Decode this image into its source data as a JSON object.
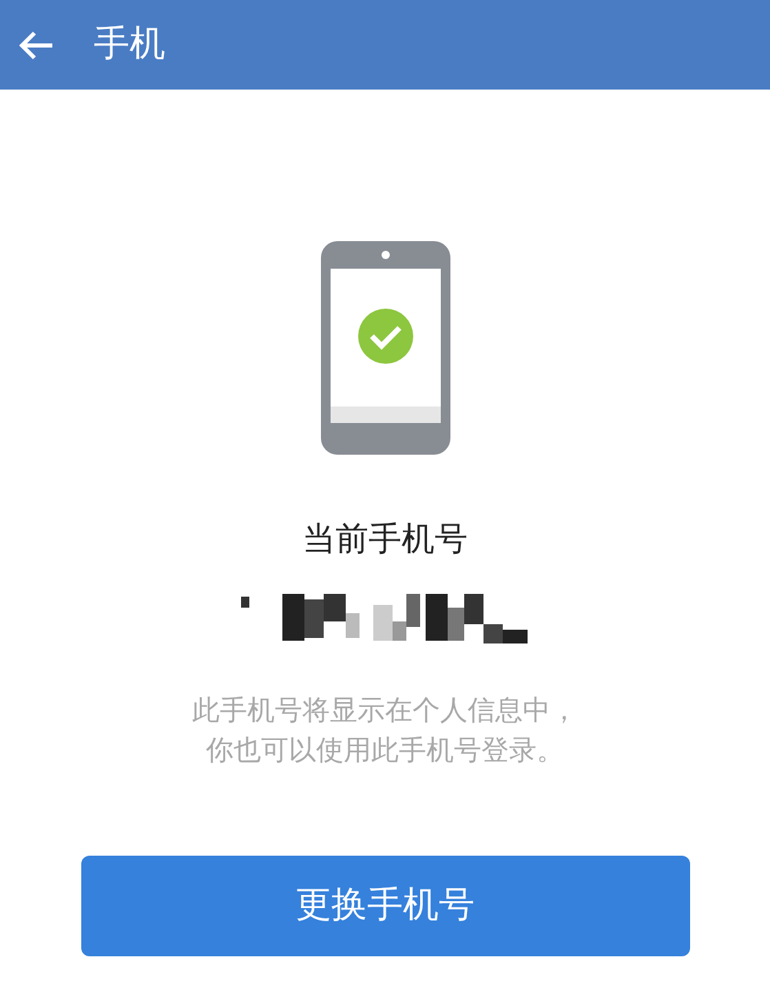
{
  "header": {
    "title": "手机"
  },
  "label": "当前手机号",
  "description": [
    "此手机号将显示在个人信息中，",
    "你也可以使用此手机号登录。"
  ],
  "button": "更换手机号"
}
